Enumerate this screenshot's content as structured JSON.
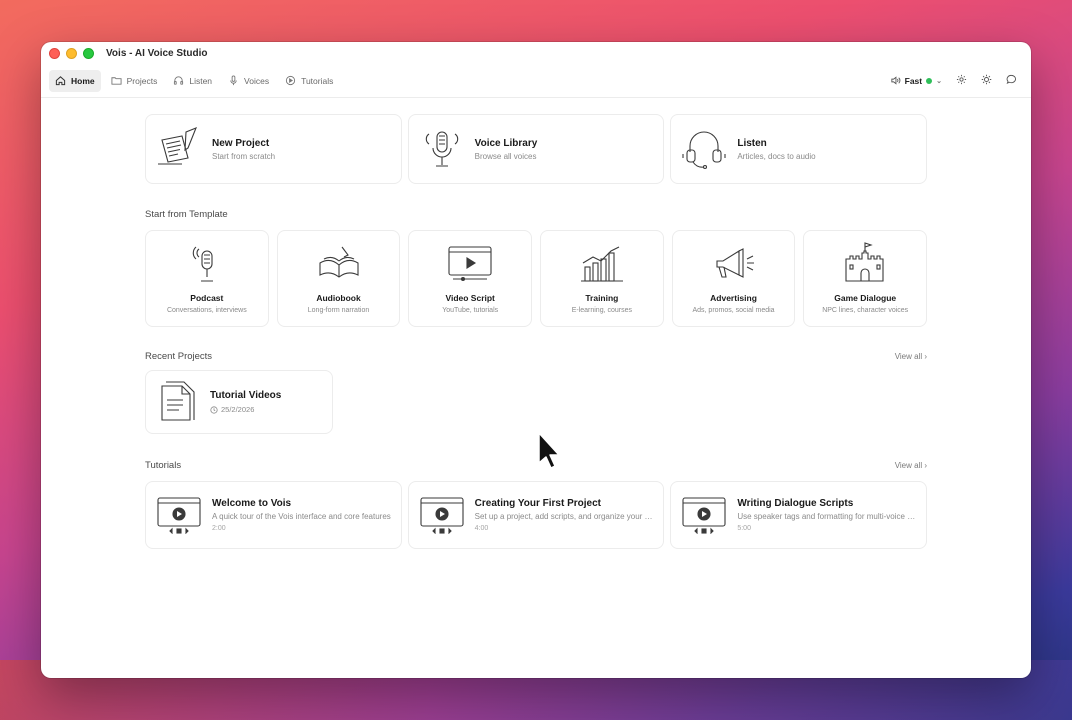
{
  "window": {
    "title": "Vois - AI Voice Studio"
  },
  "nav": {
    "items": [
      {
        "label": "Home",
        "icon": "home-icon",
        "active": true
      },
      {
        "label": "Projects",
        "icon": "folder-icon"
      },
      {
        "label": "Listen",
        "icon": "headphones-icon"
      },
      {
        "label": "Voices",
        "icon": "microphone-icon"
      },
      {
        "label": "Tutorials",
        "icon": "play-circle-icon"
      }
    ],
    "speed_label": "Fast",
    "speed_status_color": "#2fbf5a"
  },
  "quick_actions": [
    {
      "title": "New Project",
      "subtitle": "Start from scratch",
      "icon": "paper-quill-icon"
    },
    {
      "title": "Voice Library",
      "subtitle": "Browse all voices",
      "icon": "microphone-icon"
    },
    {
      "title": "Listen",
      "subtitle": "Articles, docs to audio",
      "icon": "headset-icon"
    }
  ],
  "templates": {
    "heading": "Start from Template",
    "items": [
      {
        "name": "Podcast",
        "desc": "Conversations, interviews",
        "icon": "podcast-mic-icon"
      },
      {
        "name": "Audiobook",
        "desc": "Long-form narration",
        "icon": "open-book-icon"
      },
      {
        "name": "Video Script",
        "desc": "YouTube, tutorials",
        "icon": "video-player-icon"
      },
      {
        "name": "Training",
        "desc": "E-learning, courses",
        "icon": "bar-chart-icon"
      },
      {
        "name": "Advertising",
        "desc": "Ads, promos, social media",
        "icon": "megaphone-icon"
      },
      {
        "name": "Game Dialogue",
        "desc": "NPC lines, character voices",
        "icon": "castle-icon"
      }
    ]
  },
  "recent": {
    "heading": "Recent Projects",
    "view_all": "View all",
    "items": [
      {
        "title": "Tutorial Videos",
        "date": "25/2/2026",
        "icon": "documents-icon"
      }
    ]
  },
  "tutorials": {
    "heading": "Tutorials",
    "view_all": "View all",
    "items": [
      {
        "title": "Welcome to Vois",
        "desc": "A quick tour of the Vois interface and core features",
        "duration": "2:00"
      },
      {
        "title": "Creating Your First Project",
        "desc": "Set up a project, add scripts, and organize your work",
        "duration": "4:00"
      },
      {
        "title": "Writing Dialogue Scripts",
        "desc": "Use speaker tags and formatting for multi-voice dialogue",
        "duration": "5:00"
      }
    ]
  }
}
